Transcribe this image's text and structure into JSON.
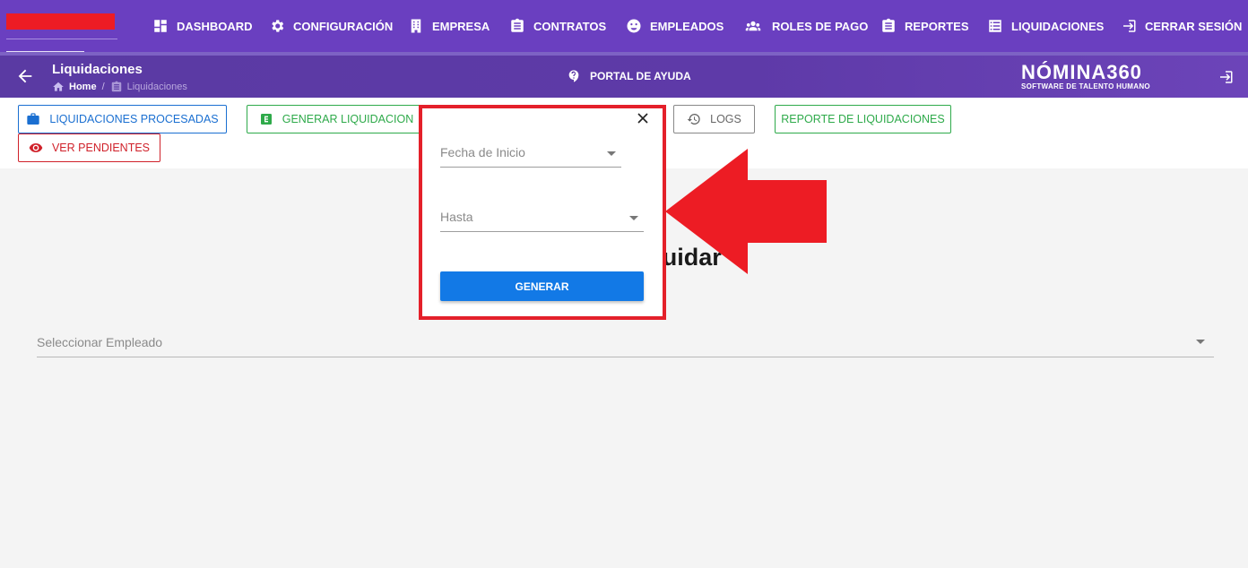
{
  "topnav": {
    "brand_color": "#ed1c24",
    "bg_color": "#6a3fc0",
    "items": [
      {
        "label": "DASHBOARD",
        "icon": "dashboard-icon"
      },
      {
        "label": "CONFIGURACIÓN",
        "icon": "gear-icon"
      },
      {
        "label": "EMPRESA",
        "icon": "building-icon"
      },
      {
        "label": "CONTRATOS",
        "icon": "clipboard-icon"
      },
      {
        "label": "EMPLEADOS",
        "icon": "face-icon"
      },
      {
        "label": "ROLES DE PAGO",
        "icon": "users-icon"
      },
      {
        "label": "REPORTES",
        "icon": "report-clipboard-icon"
      },
      {
        "label": "LIQUIDACIONES",
        "icon": "list-icon"
      },
      {
        "label": "CERRAR SESIÓN",
        "icon": "logout-icon"
      }
    ]
  },
  "subheader": {
    "title": "Liquidaciones",
    "breadcrumb": {
      "home": "Home",
      "separator": "/",
      "current": "Liquidaciones"
    },
    "help": "PORTAL DE AYUDA",
    "logo": {
      "main": "NÓMINA360",
      "sub": "SOFTWARE DE TALENTO HUMANO"
    }
  },
  "actions": {
    "processed": {
      "label": "LIQUIDACIONES PROCESADAS",
      "color": "#1a6fd1"
    },
    "generate": {
      "label": "GENERAR LIQUIDACION",
      "color": "#2eaa4a"
    },
    "logs": {
      "label": "LOGS",
      "color": "#666666"
    },
    "report": {
      "label": "REPORTE DE LIQUIDACIONES",
      "color": "#2eaa4a"
    },
    "pending": {
      "label": "VER PENDIENTES",
      "color": "#d0212a"
    }
  },
  "main": {
    "heading": "do a Liquidar",
    "employee_select_placeholder": "Seleccionar Empleado"
  },
  "popup": {
    "start_date_placeholder": "Fecha de Inicio",
    "end_date_placeholder": "Hasta",
    "generate_label": "GENERAR",
    "highlight_color": "#e4202a"
  },
  "annotation": {
    "arrow_color": "#ed1c24"
  }
}
